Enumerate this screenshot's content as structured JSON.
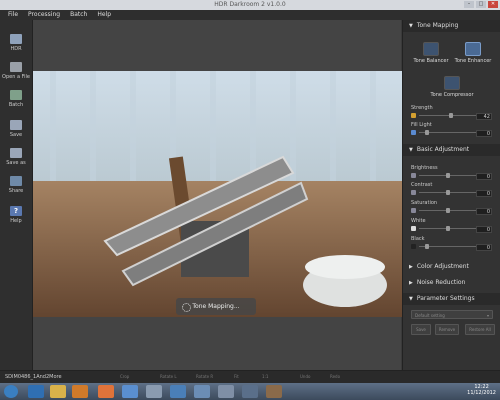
{
  "window": {
    "title": "HDR Darkroom 2 v1.0.0"
  },
  "menu": [
    "File",
    "Processing",
    "Batch",
    "Help"
  ],
  "left_toolbar": [
    {
      "label": "HDR",
      "icon": "hdr-icon"
    },
    {
      "label": "Open a File",
      "icon": "open-file-icon"
    },
    {
      "label": "Batch",
      "icon": "batch-icon"
    },
    {
      "label": "Save",
      "icon": "save-icon"
    },
    {
      "label": "Save as",
      "icon": "save-as-icon"
    },
    {
      "label": "Share",
      "icon": "share-icon"
    },
    {
      "label": "Help",
      "icon": "help-icon"
    }
  ],
  "progress": {
    "text": "Tone Mapping..."
  },
  "panel": {
    "tone_mapping": {
      "title": "Tone Mapping",
      "methods": [
        "Tone Balancer",
        "Tone Enhancer",
        "Tone Compressor"
      ],
      "selected": "Tone Enhancer",
      "strength_label": "Strength",
      "strength_value": "42",
      "strength_level": 0.55,
      "fill_light_label": "Fill Light",
      "fill_light_value": "0",
      "fill_light_level": 0.12
    },
    "basic": {
      "title": "Basic Adjustment",
      "sliders": [
        {
          "label": "Brightness",
          "value": "0",
          "level": 0.5
        },
        {
          "label": "Contrast",
          "value": "0",
          "level": 0.5
        },
        {
          "label": "Saturation",
          "value": "0",
          "level": 0.5
        },
        {
          "label": "White",
          "value": "0",
          "level": 0.5
        },
        {
          "label": "Black",
          "value": "0",
          "level": 0.12
        }
      ]
    },
    "color_adjustment": "Color Adjustment",
    "noise_reduction": "Noise Reduction",
    "parameter_settings": {
      "title": "Parameter Settings",
      "dropdown": "Default setting",
      "buttons": [
        "Save",
        "Remove",
        "Restore All"
      ]
    }
  },
  "statusbar": {
    "file": "SDIM0486_1And2More",
    "tools": [
      "Crop",
      "Rotate L",
      "Rotate R",
      "Fit",
      "1:1",
      "Undo",
      "Redo"
    ]
  },
  "taskbar": {
    "time": "12:22",
    "date": "11/12/2012"
  },
  "colors": {
    "accent": "#4a6a94",
    "panel": "#333333",
    "taskbar": "#4a5b70"
  }
}
